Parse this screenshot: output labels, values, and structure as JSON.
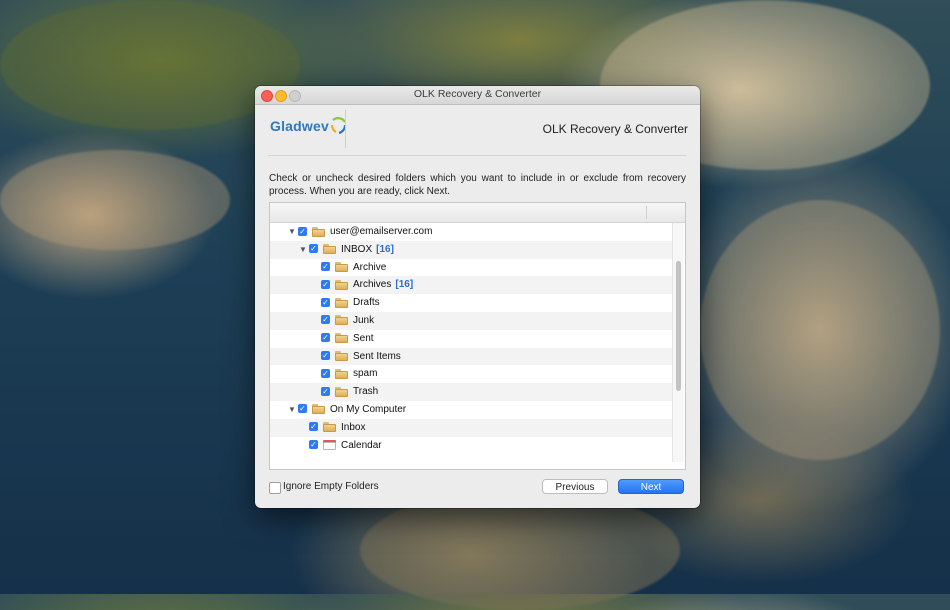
{
  "window": {
    "title": "OLK Recovery & Converter"
  },
  "header": {
    "logo_text": "Gladwev",
    "product_name": "OLK Recovery & Converter"
  },
  "instructions": "Check or uncheck desired folders which you want to include in or exclude from recovery process. When you are ready, click Next.",
  "tree": {
    "rows": [
      {
        "label": "user@emailserver.com",
        "count": "",
        "level": 0,
        "checked": true,
        "expanded": true,
        "icon": "folder-icon"
      },
      {
        "label": "INBOX",
        "count": "[16]",
        "level": 1,
        "checked": true,
        "expanded": true,
        "icon": "folder-icon"
      },
      {
        "label": "Archive",
        "count": "",
        "level": 2,
        "checked": true,
        "icon": "folder-icon"
      },
      {
        "label": "Archives",
        "count": "[16]",
        "level": 2,
        "checked": true,
        "icon": "folder-icon"
      },
      {
        "label": "Drafts",
        "count": "",
        "level": 2,
        "checked": true,
        "icon": "folder-icon"
      },
      {
        "label": "Junk",
        "count": "",
        "level": 2,
        "checked": true,
        "icon": "folder-icon"
      },
      {
        "label": "Sent",
        "count": "",
        "level": 2,
        "checked": true,
        "icon": "folder-icon"
      },
      {
        "label": "Sent Items",
        "count": "",
        "level": 2,
        "checked": true,
        "icon": "folder-icon"
      },
      {
        "label": "spam",
        "count": "",
        "level": 2,
        "checked": true,
        "icon": "folder-icon"
      },
      {
        "label": "Trash",
        "count": "",
        "level": 2,
        "checked": true,
        "icon": "folder-icon"
      },
      {
        "label": "On My Computer",
        "count": "",
        "level": 0,
        "checked": true,
        "expanded": true,
        "icon": "folder-icon"
      },
      {
        "label": "Inbox",
        "count": "",
        "level": 1,
        "checked": true,
        "icon": "folder-icon"
      },
      {
        "label": "Calendar",
        "count": "",
        "level": 1,
        "checked": true,
        "icon": "calendar-icon"
      }
    ]
  },
  "footer": {
    "ignore_empty_label": "Ignore Empty Folders",
    "ignore_empty_checked": false,
    "previous_label": "Previous",
    "next_label": "Next"
  },
  "colors": {
    "accent": "#2d7bf4",
    "count": "#2a6fc9"
  }
}
